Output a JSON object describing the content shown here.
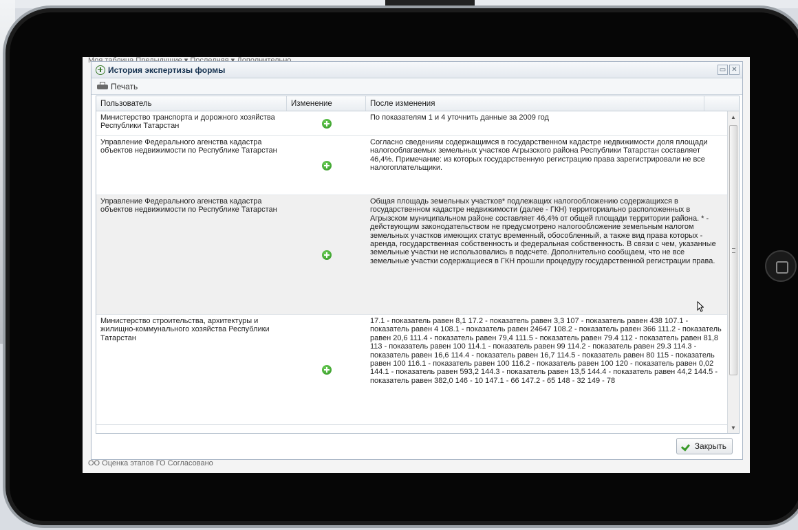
{
  "backdrop": {
    "under_top": "Моя таблица  Предыдущие  ▾  Последняя  ▾  Дополнительно",
    "under_bottom": "ОО   Оценка этапов ГО   Согласовано"
  },
  "window": {
    "title": "История экспертизы формы",
    "restore_label": "▭",
    "close_label": "✕"
  },
  "toolbar": {
    "print_label": "Печать"
  },
  "grid": {
    "columns": [
      "Пользователь",
      "Изменение",
      "После изменения"
    ],
    "rows": [
      {
        "user": "Министерство транспорта и дорожного хозяйства Республики Татарстан",
        "change_icon": "add-icon",
        "after": "По показателям 1 и 4 уточнить данные за 2009 год"
      },
      {
        "user": "Управление Федерального агенства кадастра объектов недвижимости по Республике Татарстан",
        "change_icon": "add-icon",
        "after": "Согласно сведениям содержащимся в государственном кадастре недвижимости доля площади налогооблагаемых земельных участков Агрызского района Республики Татарстан составляет 46,4%. Примечание: из которых государственную регистрацию права зарегистрировали не все налогоплательщики."
      },
      {
        "user": "Управление Федерального агенства кадастра объектов недвижимости по Республике Татарстан",
        "change_icon": "add-icon",
        "after": "Общая площадь земельных участков* подлежащих налогообложению содержащихся в государственном кадастре недвижимости (далее - ГКН) территориально расположенных в Агрызском муниципальном районе составляет 46,4% от общей площади территории района. * - действующим законодательством не предусмотрено налогообложение земельным налогом земельных участков имеющих статус временный, обособленный, а также вид права которых - аренда, государственная собственность и федеральная собственность. В связи с чем, указанные земельные участки не использовались в подсчете. Дополнительно сообщаем, что не все земельные участки содержащиеся в ГКН прошли процедуру государственной регистрации права."
      },
      {
        "user": "Министерство строительства, архитектуры и жилищно-коммунального хозяйства Республики Татарстан",
        "change_icon": "add-icon",
        "after": "17.1 - показатель равен 8,1 17.2 - показатель равен 3,3 107 - показатель равен 438 107.1 - показатель равен 4 108.1 - показатель равен 24647 108.2 - показатель равен 366 111.2 - показатель равен 20,6 111.4 - показатель равен 79,4 111.5 - показатель равен 79.4 112 - показатель равен 81,8 113 - показатель равен 100 114.1 - показатель равен 99 114.2 - показатель равен 29.3 114.3 - показатель равен 16,6 114.4 - показатель равен 16,7 114.5 - показатель равен 80 115 - показатель равен 100 116.1 - показатель равен 100 116.2 - показатель равен 100 120 - показатель равен 0,02 144.1 - показатель равен 593,2 144.3 - показатель равен 13,5 144.4 - показатель равен 44,2 144.5 - показатель равен 382,0 146 - 10 147.1 - 66 147.2 - 65 148 - 32 149 - 78"
      }
    ]
  },
  "footer": {
    "close_label": "Закрыть"
  }
}
